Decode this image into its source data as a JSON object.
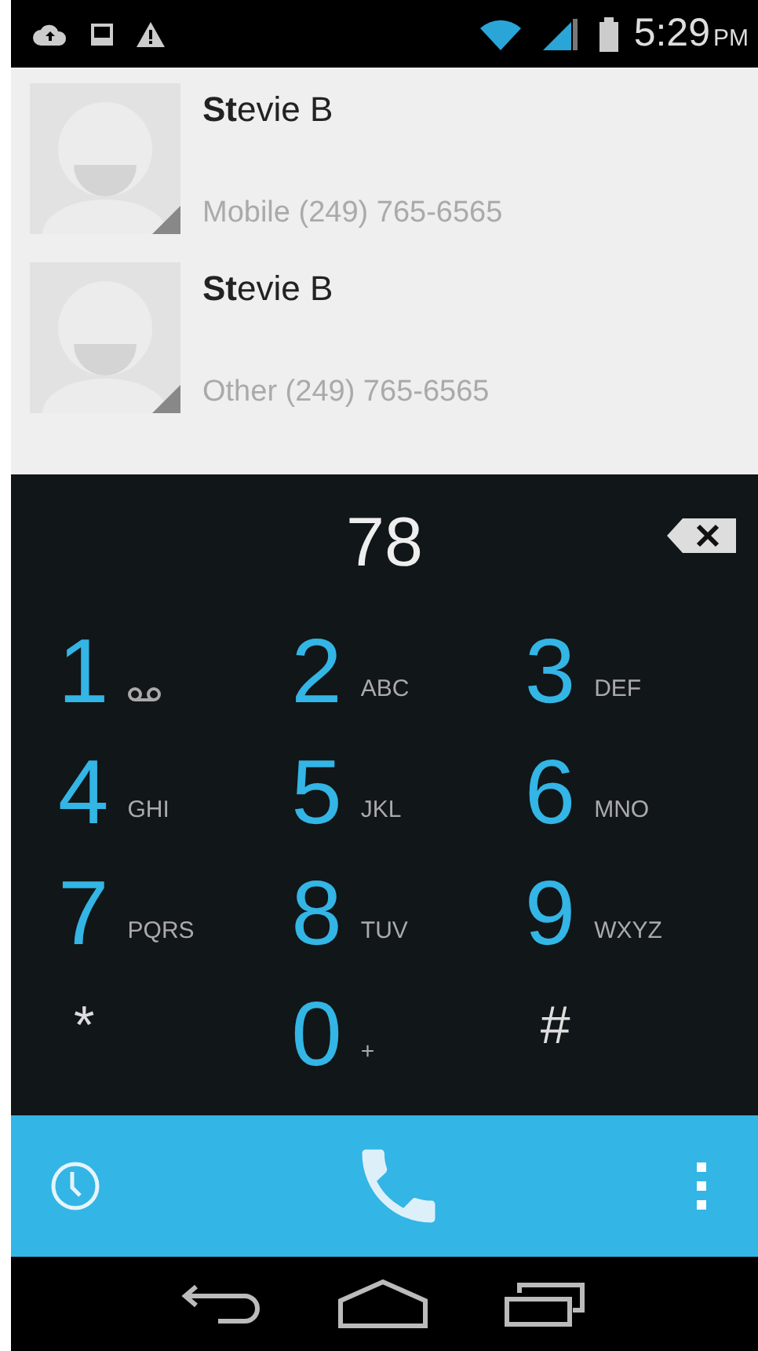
{
  "status_bar": {
    "time": "5:29",
    "meridiem": "PM"
  },
  "contacts": [
    {
      "name": "**St**evie B",
      "detail": "Mobile (249) 765-6565"
    },
    {
      "name": "**St**evie B",
      "detail": "Other (249) 765-6565"
    }
  ],
  "dialpad": {
    "number": "78",
    "keys": [
      {
        "digit": "1",
        "kind": "voicemail"
      },
      {
        "digit": "2",
        "letters": "ABC",
        "kind": "letters"
      },
      {
        "digit": "3",
        "letters": "DEF",
        "kind": "letters"
      },
      {
        "digit": "4",
        "letters": "GHI",
        "kind": "letters"
      },
      {
        "digit": "5",
        "letters": "JKL",
        "kind": "letters"
      },
      {
        "digit": "6",
        "letters": "MNO",
        "kind": "letters"
      },
      {
        "digit": "7",
        "letters": "PQRS",
        "kind": "letters"
      },
      {
        "digit": "8",
        "letters": "TUV",
        "kind": "letters"
      },
      {
        "digit": "9",
        "letters": "WXYZ",
        "kind": "letters"
      },
      {
        "digit": "*",
        "kind": "symbol"
      },
      {
        "digit": "0",
        "letters": "+",
        "kind": "letters"
      },
      {
        "digit": "#",
        "kind": "symbol"
      }
    ]
  }
}
